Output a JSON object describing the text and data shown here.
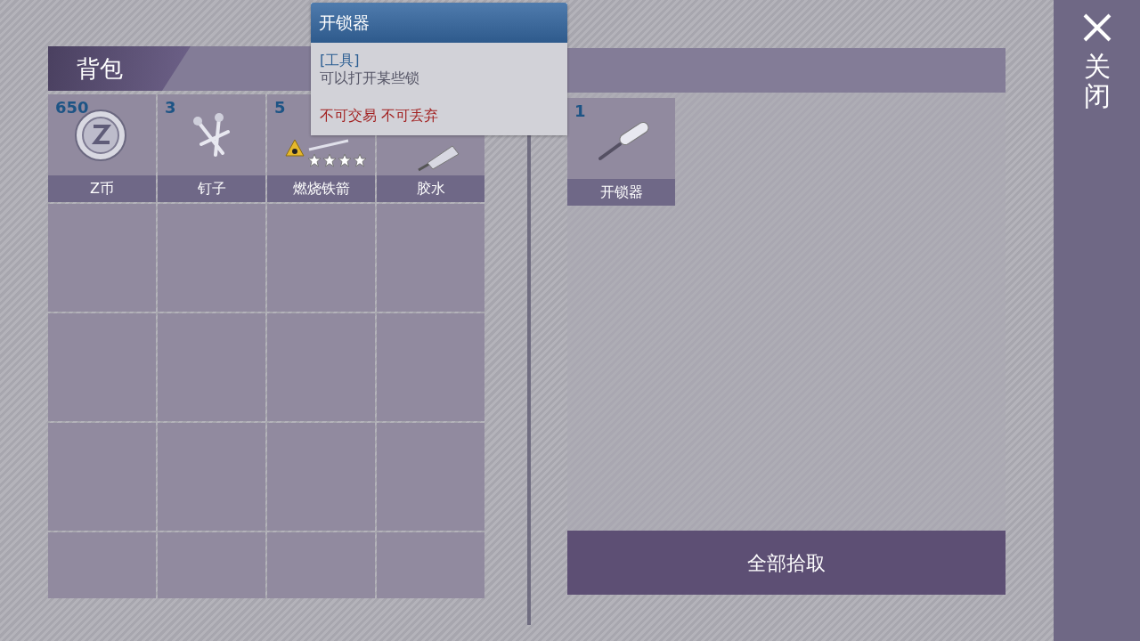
{
  "backpack": {
    "title": "背包",
    "slots": [
      {
        "count": "650",
        "name": "Z币",
        "kind": "coin"
      },
      {
        "count": "3",
        "name": "钉子",
        "kind": "nails"
      },
      {
        "count": "5",
        "name": "燃烧铁箭",
        "kind": "fire-arrow",
        "stars": 4
      },
      {
        "name": "胶水",
        "kind": "glue"
      }
    ]
  },
  "tooltip": {
    "title": "开锁器",
    "category": "[工具]",
    "description": "可以打开某些锁",
    "restriction": "不可交易 不可丢弃"
  },
  "loot": {
    "slots": [
      {
        "count": "1",
        "name": "开锁器",
        "kind": "screwdriver"
      }
    ],
    "button": "全部拾取"
  },
  "close": {
    "label": "关闭"
  }
}
